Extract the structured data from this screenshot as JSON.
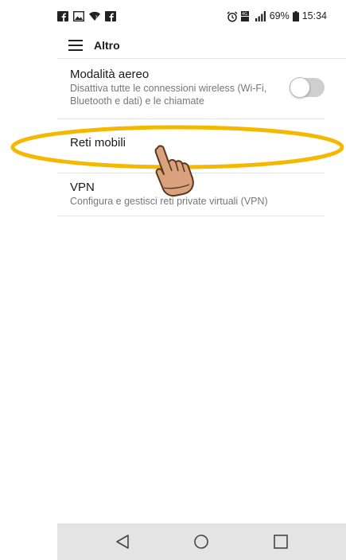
{
  "status_bar": {
    "battery_percent": "69%",
    "time": "15:34",
    "left_icons": [
      "facebook-icon",
      "image-icon",
      "wifi-icon",
      "facebook-icon"
    ],
    "right_icons": [
      "alarm-icon",
      "data-4g-icon",
      "signal-icon",
      "battery-icon"
    ]
  },
  "app_bar": {
    "title": "Altro",
    "menu_icon": "hamburger-menu-icon"
  },
  "settings": {
    "airplane": {
      "title": "Modalità aereo",
      "description": "Disattiva tutte le connessioni wireless (Wi-Fi, Bluetooth e dati) e le chiamate",
      "enabled": false
    },
    "mobile_networks": {
      "title": "Reti mobili"
    },
    "vpn": {
      "title": "VPN",
      "description": "Configura e gestisci reti private virtuali (VPN)"
    }
  },
  "annotation": {
    "highlight_color": "#f5b800",
    "pointer": "hand-pointer-icon"
  },
  "nav_bar": {
    "back": "back-triangle-icon",
    "home": "home-circle-icon",
    "recents": "recents-square-icon"
  }
}
